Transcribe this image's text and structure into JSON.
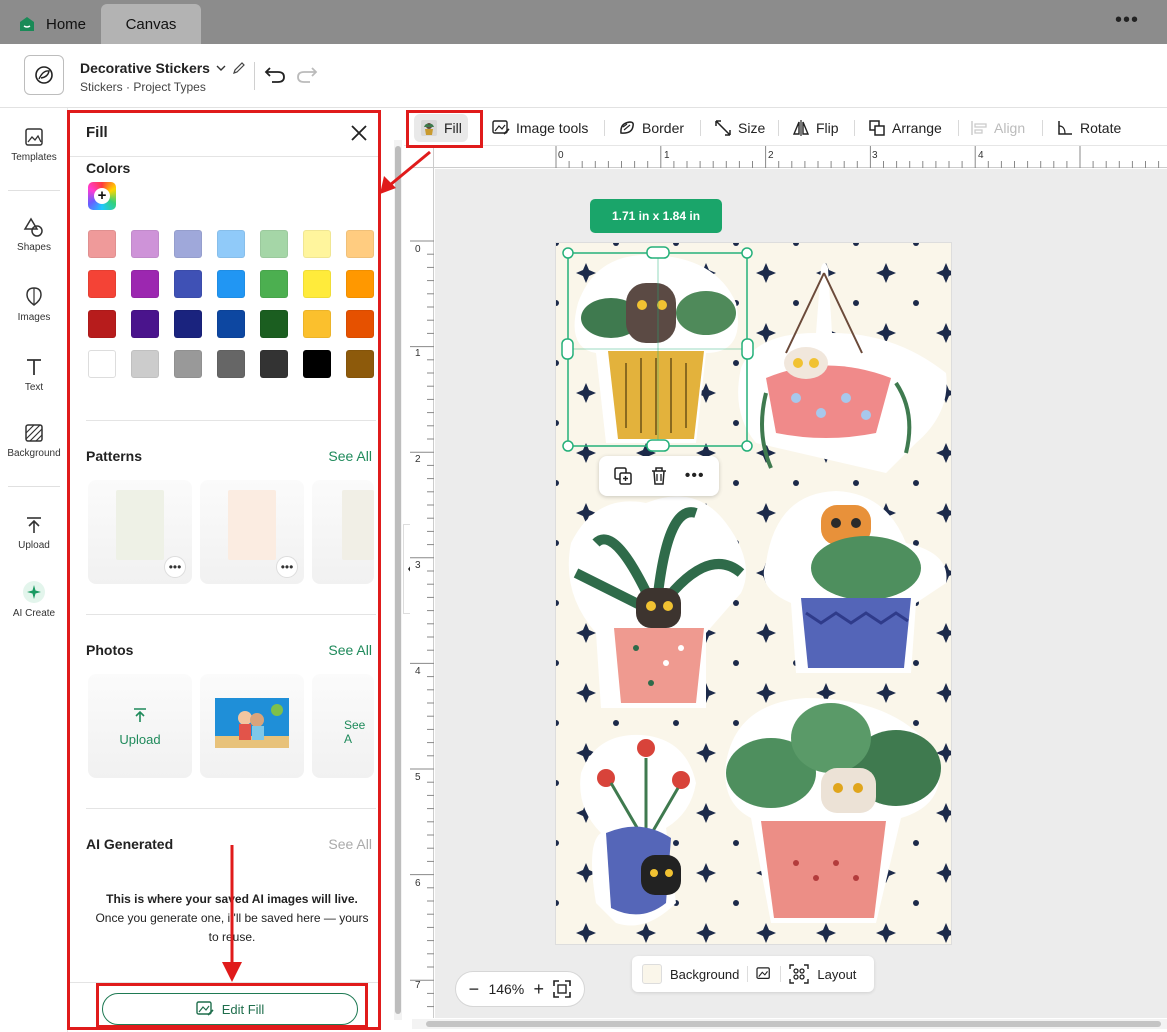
{
  "tabs": {
    "home": "Home",
    "canvas": "Canvas"
  },
  "header": {
    "title": "Decorative Stickers",
    "breadcrumb": "Stickers  ·  Project Types"
  },
  "rail": [
    {
      "label": "Templates",
      "icon": "templates-icon"
    },
    {
      "label": "Shapes",
      "icon": "shapes-icon"
    },
    {
      "label": "Images",
      "icon": "images-icon"
    },
    {
      "label": "Text",
      "icon": "text-icon"
    },
    {
      "label": "Background",
      "icon": "background-icon"
    },
    {
      "label": "Upload",
      "icon": "upload-icon"
    },
    {
      "label": "AI Create",
      "icon": "ai-create-icon"
    }
  ],
  "panel": {
    "title": "Fill",
    "colors_label": "Colors",
    "swatches": [
      [
        "#ef9a9a",
        "#ce93d8",
        "#9fa8da",
        "#90caf9",
        "#a5d6a7",
        "#fff59d",
        "#ffcc80"
      ],
      [
        "#f44336",
        "#9c27b0",
        "#3f51b5",
        "#2196f3",
        "#4caf50",
        "#ffeb3b",
        "#ff9800"
      ],
      [
        "#b71c1c",
        "#4a148c",
        "#1a237e",
        "#0d47a1",
        "#1b5e20",
        "#fbc02d",
        "#e65100"
      ],
      [
        "#ffffff",
        "#cccccc",
        "#999999",
        "#666666",
        "#333333",
        "#000000",
        "#8d5a0b"
      ]
    ],
    "patterns_label": "Patterns",
    "photos_label": "Photos",
    "ai_label": "AI Generated",
    "see_all": "See All",
    "see_all_cut": "See A",
    "upload_label": "Upload",
    "ai_msg_bold": "This is where your saved AI images will live.",
    "ai_msg": "Once you generate one, it'll be saved here — yours to reuse.",
    "edit_fill": "Edit Fill"
  },
  "toolbar": {
    "fill": "Fill",
    "image_tools": "Image tools",
    "border": "Border",
    "size": "Size",
    "flip": "Flip",
    "arrange": "Arrange",
    "align": "Align",
    "rotate": "Rotate"
  },
  "ruler_h": [
    "0",
    "1",
    "2",
    "3",
    "4"
  ],
  "ruler_v": [
    "0",
    "1",
    "2",
    "3",
    "4",
    "5",
    "6",
    "7"
  ],
  "selection_size": "1.71  in x 1.84  in",
  "zoom": "146%",
  "bottom_bar": {
    "background": "Background",
    "layout": "Layout"
  }
}
